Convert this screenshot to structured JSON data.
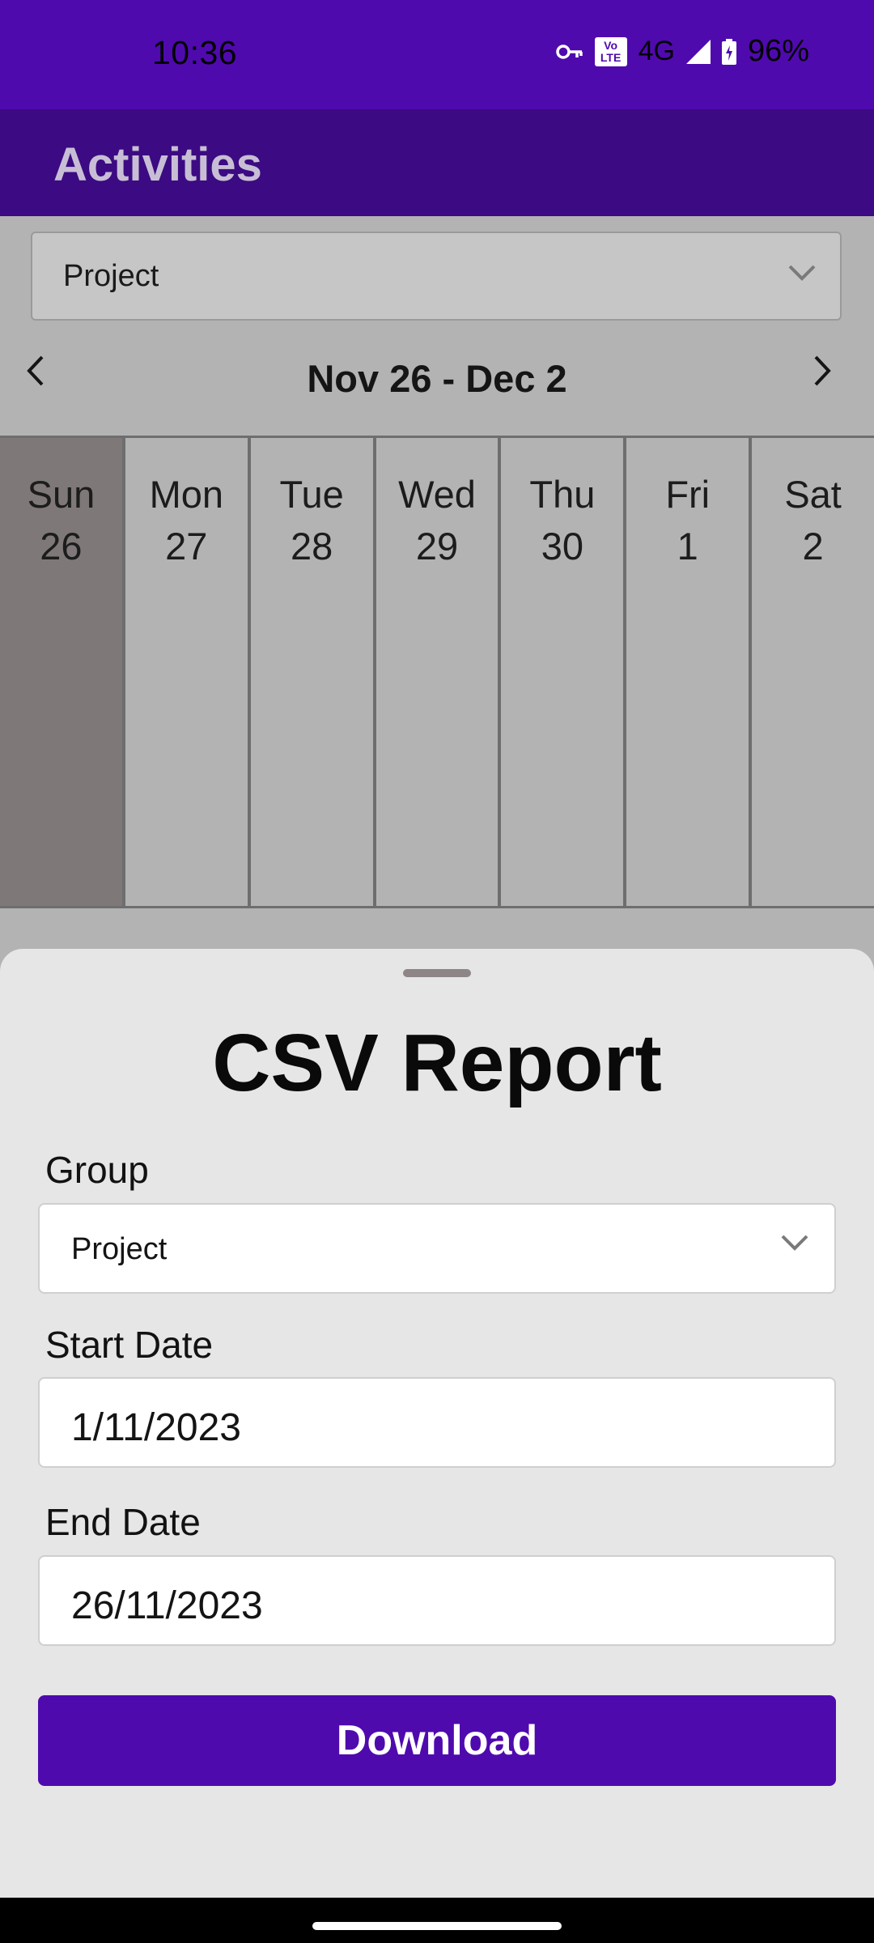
{
  "status_bar": {
    "time": "10:36",
    "network": "4G",
    "battery": "96%",
    "icons": [
      "vpn-key-icon",
      "volte-icon",
      "signal-icon",
      "battery-charging-icon"
    ],
    "volte_label_top": "Vo",
    "volte_label_bottom": "LTE"
  },
  "app_bar": {
    "title": "Activities"
  },
  "background": {
    "group_select": "Project",
    "week_range": "Nov 26 - Dec 2",
    "days": [
      {
        "name": "Sun",
        "num": "26"
      },
      {
        "name": "Mon",
        "num": "27"
      },
      {
        "name": "Tue",
        "num": "28"
      },
      {
        "name": "Wed",
        "num": "29"
      },
      {
        "name": "Thu",
        "num": "30"
      },
      {
        "name": "Fri",
        "num": "1"
      },
      {
        "name": "Sat",
        "num": "2"
      }
    ],
    "selected_day": "Sun"
  },
  "sheet": {
    "title": "CSV Report",
    "group_label": "Group",
    "group_value": "Project",
    "start_label": "Start Date",
    "start_value": "1/11/2023",
    "end_label": "End Date",
    "end_value": "26/11/2023",
    "download_label": "Download"
  },
  "colors": {
    "status_bar": "#4f0aae",
    "app_bar": "#3c0a82",
    "accent": "#4f0aae",
    "selected_day": "#7f7878"
  }
}
